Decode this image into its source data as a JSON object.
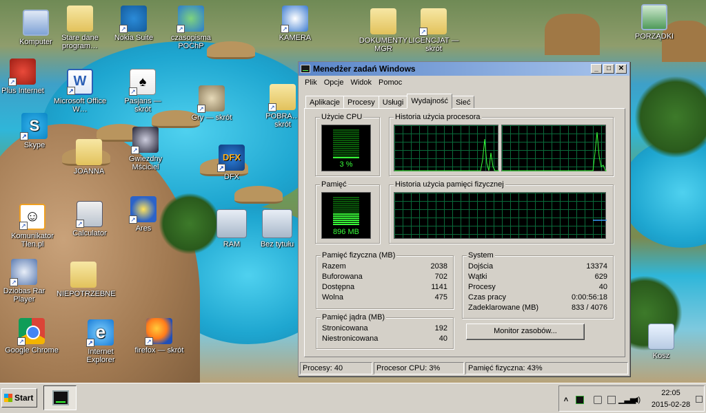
{
  "desktop": {
    "icons": [
      {
        "label": "Komputer",
        "icon": "computer-icon"
      },
      {
        "label": "Stare dane program…",
        "icon": "folder-icon"
      },
      {
        "label": "Nokia Suite",
        "icon": "nokia-suite-icon"
      },
      {
        "label": "czasopisma POChP",
        "icon": "network-icon"
      },
      {
        "label": "KAMERA",
        "icon": "camera-icon"
      },
      {
        "label": "DOKUMENTY MGR",
        "icon": "folder-icon"
      },
      {
        "label": "LICENCJAT — skrót",
        "icon": "folder-icon"
      },
      {
        "label": "PORZĄDKI",
        "icon": "computer-network-icon"
      },
      {
        "label": "Plus Internet",
        "icon": "plus-internet-icon"
      },
      {
        "label": "Microsoft Office W…",
        "icon": "word-icon"
      },
      {
        "label": "Pasjans — skrót",
        "icon": "solitaire-icon"
      },
      {
        "label": "Gry — skrót",
        "icon": "chess-icon"
      },
      {
        "label": "POBRA… skrót",
        "icon": "folder-icon"
      },
      {
        "label": "Skype",
        "icon": "skype-icon"
      },
      {
        "label": "JOANNA",
        "icon": "user-folder-icon"
      },
      {
        "label": "Gwiezdny Mściciel",
        "icon": "game-icon"
      },
      {
        "label": "DFX",
        "icon": "dfx-icon"
      },
      {
        "label": "Komunikator Tlen.pl",
        "icon": "tlen-icon"
      },
      {
        "label": "Calculator",
        "icon": "calculator-icon"
      },
      {
        "label": "Ares",
        "icon": "ares-icon"
      },
      {
        "label": "RAM",
        "icon": "image-thumbnail-icon"
      },
      {
        "label": "Bez tytułu",
        "icon": "image-thumbnail-icon"
      },
      {
        "label": "Dziobas Rar Player",
        "icon": "player-icon"
      },
      {
        "label": "NIEPOTRZEBNE",
        "icon": "pdf-folder-icon"
      },
      {
        "label": "Google Chrome",
        "icon": "chrome-icon"
      },
      {
        "label": "Internet Explorer",
        "icon": "ie-icon"
      },
      {
        "label": "firefox — skrót",
        "icon": "firefox-icon"
      },
      {
        "label": "Kosz",
        "icon": "recycle-bin-icon"
      }
    ]
  },
  "window": {
    "title": "Menedżer zadań Windows",
    "controls": {
      "minimize": "_",
      "maximize": "□",
      "close": "✕"
    },
    "menu": [
      "Plik",
      "Opcje",
      "Widok",
      "Pomoc"
    ],
    "tabs": [
      "Aplikacje",
      "Procesy",
      "Usługi",
      "Wydajność",
      "Sieć"
    ],
    "active_tab": "Wydajność",
    "cpu": {
      "label": "Użycie CPU",
      "value_text": "3 %",
      "percent": 3
    },
    "cpu_history": {
      "label": "Historia użycia procesora"
    },
    "memory": {
      "label": "Pamięć",
      "value_text": "896 MB",
      "percent": 43
    },
    "memory_history": {
      "label": "Historia użycia pamięci fizycznej"
    },
    "physical": {
      "label": "Pamięć fizyczna (MB)",
      "rows": [
        {
          "k": "Razem",
          "v": "2038"
        },
        {
          "k": "Buforowana",
          "v": "702"
        },
        {
          "k": "Dostępna",
          "v": "1141"
        },
        {
          "k": "Wolna",
          "v": "475"
        }
      ]
    },
    "kernel": {
      "label": "Pamięć jądra (MB)",
      "rows": [
        {
          "k": "Stronicowana",
          "v": "192"
        },
        {
          "k": "Niestronicowana",
          "v": "40"
        }
      ]
    },
    "system": {
      "label": "System",
      "rows": [
        {
          "k": "Dojścia",
          "v": "13374"
        },
        {
          "k": "Wątki",
          "v": "629"
        },
        {
          "k": "Procesy",
          "v": "40"
        },
        {
          "k": "Czas pracy",
          "v": "0:00:56:18"
        },
        {
          "k": "Zadeklarowane (MB)",
          "v": "833 / 4076"
        }
      ]
    },
    "monitor_button": "Monitor zasobów...",
    "status": {
      "processes": "Procesy: 40",
      "cpu": "Procesor CPU: 3%",
      "memory": "Pamięć fizyczna: 43%"
    }
  },
  "taskbar": {
    "start_label": "Start",
    "clock_time": "22:05",
    "clock_date": "2015-02-28"
  }
}
